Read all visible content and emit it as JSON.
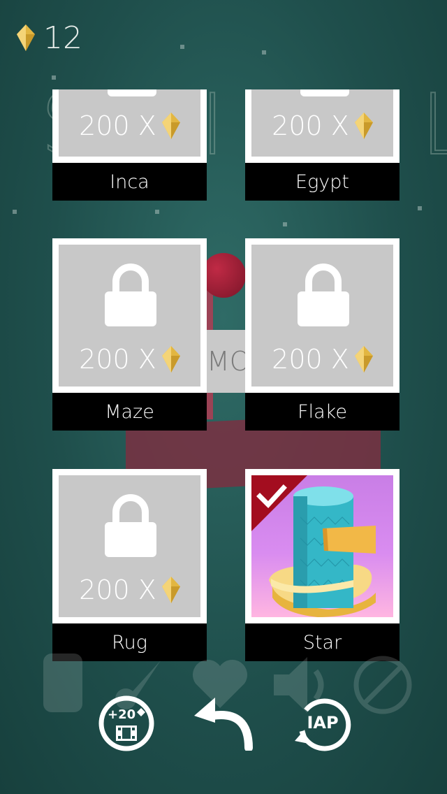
{
  "header": {
    "gem_count": "12",
    "gem_icon": "gem-icon"
  },
  "cards": [
    {
      "name": "Inca",
      "price": "200 X",
      "locked": true
    },
    {
      "name": "Egypt",
      "price": "200 X",
      "locked": true
    },
    {
      "name": "Maze",
      "price": "200 X",
      "locked": true
    },
    {
      "name": "Flake",
      "price": "200 X",
      "locked": true
    },
    {
      "name": "Rug",
      "price": "200 X",
      "locked": true
    },
    {
      "name": "Star",
      "price": "",
      "locked": false,
      "selected": true
    }
  ],
  "background": {
    "partial_text": "MO"
  },
  "buttons": {
    "free_gems": {
      "label": "+20",
      "icon": "video-reward-icon"
    },
    "back": {
      "icon": "back-arrow-icon"
    },
    "iap": {
      "label": "IAP",
      "icon": "iap-restore-icon"
    }
  },
  "colors": {
    "gem": "#e2b641",
    "selected_ribbon": "#a30d1f",
    "card_bg": "#c8c8c8"
  }
}
